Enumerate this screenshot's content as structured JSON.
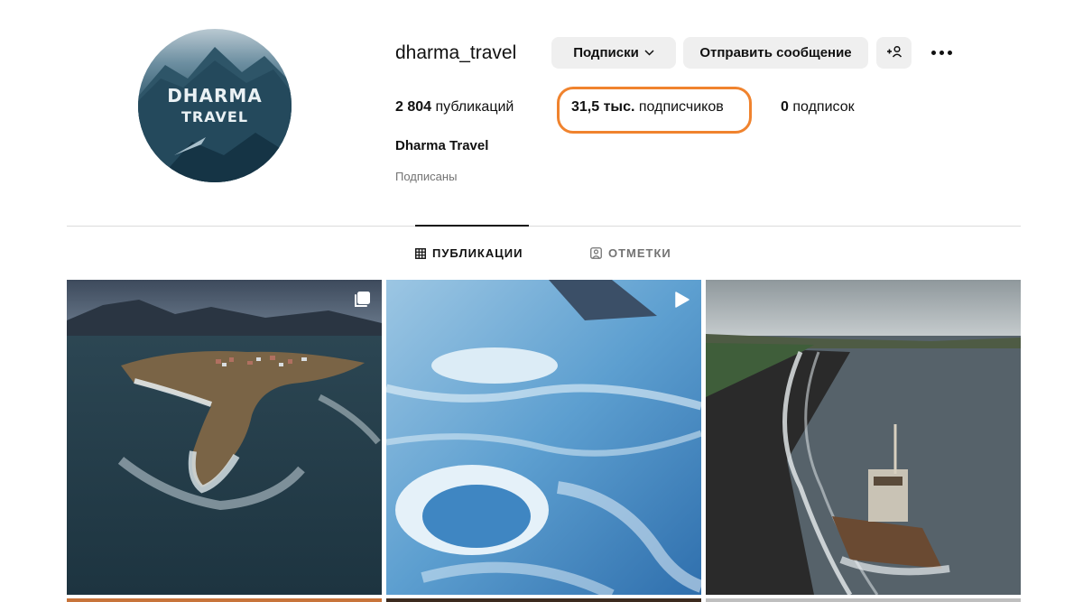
{
  "profile": {
    "username": "dharma_travel",
    "avatar_brand_line1": "DHARMA",
    "avatar_brand_line2": "TRAVEL",
    "full_name": "Dharma Travel",
    "mutual_text": "Подписаны"
  },
  "actions": {
    "following_label": "Подписки",
    "following_icon": "chevron-down-icon",
    "message_label": "Отправить сообщение",
    "add_user_icon": "add-user-icon",
    "more_icon": "more-options-icon"
  },
  "stats": {
    "posts_count": "2 804",
    "posts_label": "публикаций",
    "followers_count": "31,5 тыс.",
    "followers_label": "подписчиков",
    "following_count": "0",
    "following_label": "подписок"
  },
  "annotation": {
    "highlight_color": "#f0832e"
  },
  "tabs": [
    {
      "label": "ПУБЛИКАЦИИ",
      "icon": "grid-icon",
      "active": true
    },
    {
      "label": "ОТМЕТКИ",
      "icon": "tagged-icon",
      "active": false
    }
  ],
  "posts": [
    {
      "description_icon": "carousel-icon"
    },
    {
      "description_icon": "reel-play-icon"
    },
    {
      "description_icon": ""
    }
  ]
}
